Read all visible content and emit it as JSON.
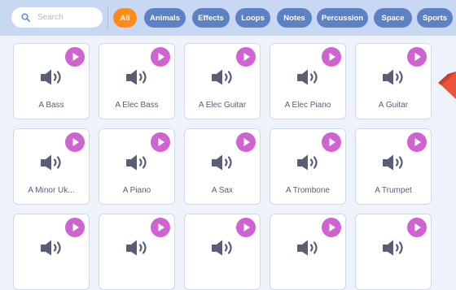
{
  "search": {
    "placeholder": "Search"
  },
  "categories": [
    {
      "label": "All",
      "active": true
    },
    {
      "label": "Animals"
    },
    {
      "label": "Effects"
    },
    {
      "label": "Loops"
    },
    {
      "label": "Notes"
    },
    {
      "label": "Percussion"
    },
    {
      "label": "Space"
    },
    {
      "label": "Sports"
    }
  ],
  "sounds": [
    {
      "name": "A Bass"
    },
    {
      "name": "A Elec Bass"
    },
    {
      "name": "A Elec Guitar"
    },
    {
      "name": "A Elec Piano"
    },
    {
      "name": "A Guitar"
    },
    {
      "name": "A Minor Uk..."
    },
    {
      "name": "A Piano"
    },
    {
      "name": "A Sax"
    },
    {
      "name": "A Trombone"
    },
    {
      "name": "A Trumpet"
    },
    {
      "name": ""
    },
    {
      "name": ""
    },
    {
      "name": ""
    },
    {
      "name": ""
    },
    {
      "name": ""
    }
  ],
  "colors": {
    "accent_active": "#ff8c1a",
    "category_pill": "#5c81c4",
    "play_button": "#cf63cf",
    "speaker_icon": "#575e75",
    "arrow": "#e8533a"
  },
  "icons": {
    "search": "search-icon",
    "play": "play-icon",
    "sound": "speaker-icon",
    "arrow": "arrow-icon"
  }
}
